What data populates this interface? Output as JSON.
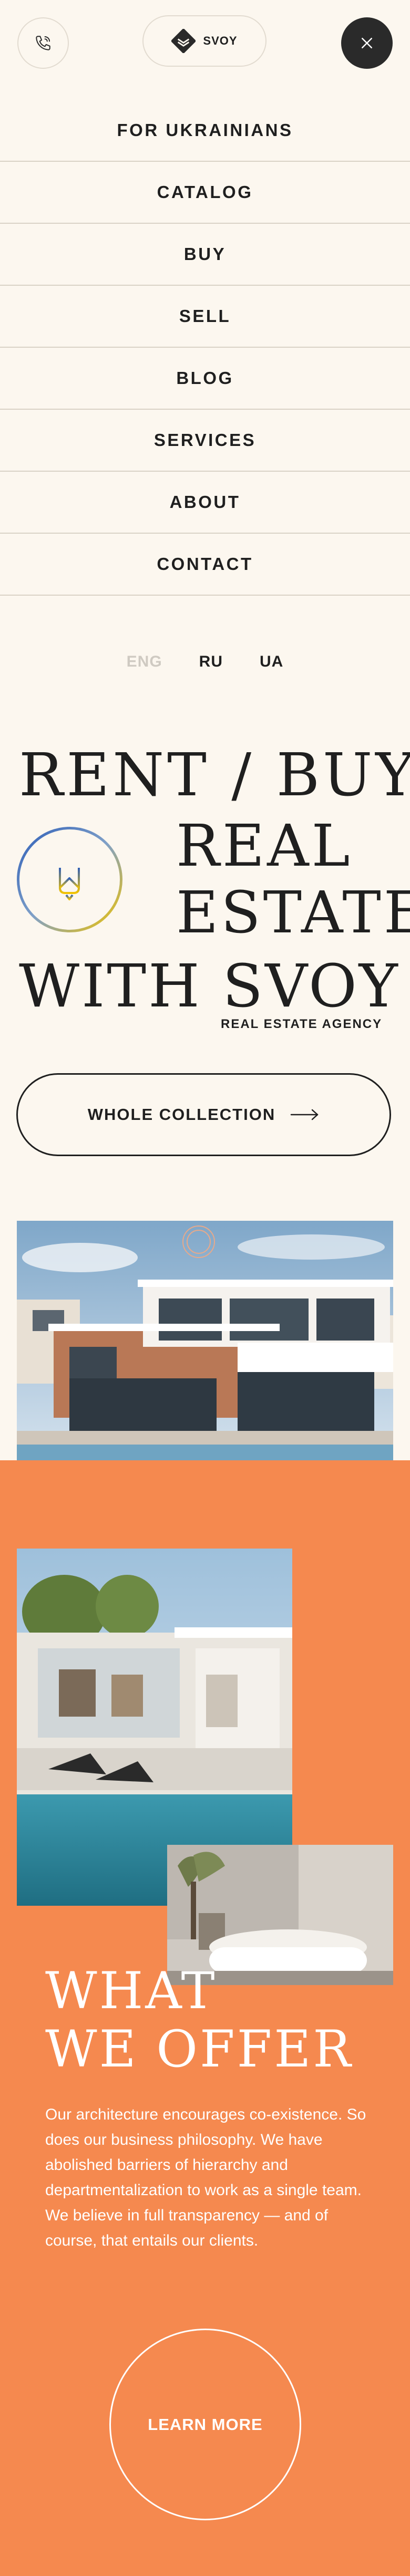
{
  "header": {
    "logo_text": "SVOY",
    "phone_icon": "phone-icon",
    "close_icon": "close-icon"
  },
  "nav": {
    "items": [
      {
        "label": "FOR UKRAINIANS"
      },
      {
        "label": "CATALOG"
      },
      {
        "label": "BUY"
      },
      {
        "label": "SELL"
      },
      {
        "label": "BLOG"
      },
      {
        "label": "SERVICES"
      },
      {
        "label": "ABOUT"
      },
      {
        "label": "CONTACT"
      }
    ]
  },
  "languages": {
    "active": "ENG",
    "options": [
      "ENG",
      "RU",
      "UA"
    ]
  },
  "hero": {
    "line1": "RENT / BUY",
    "line2": "REAL",
    "line3": "ESTATE",
    "line4": "WITH SVOY",
    "tagline": "REAL ESTATE AGENCY",
    "badge_icon": "ukraine-trident-icon"
  },
  "cta": {
    "label": "WHOLE COLLECTION",
    "icon": "arrow-right-icon"
  },
  "offer": {
    "title_line1": "WHAT",
    "title_line2": "WE OFFER",
    "text": "Our architecture encourages co-existence. So does our business philosophy. We have abolished barriers of hierarchy and departmentalization to work as a single team. We believe in full transparency — and of course, that entails our clients.",
    "button_label": "LEARN MORE"
  },
  "colors": {
    "background": "#fcf7ef",
    "accent_orange": "#f5894f",
    "dark": "#1f1f1f",
    "muted": "#cfcac2"
  }
}
